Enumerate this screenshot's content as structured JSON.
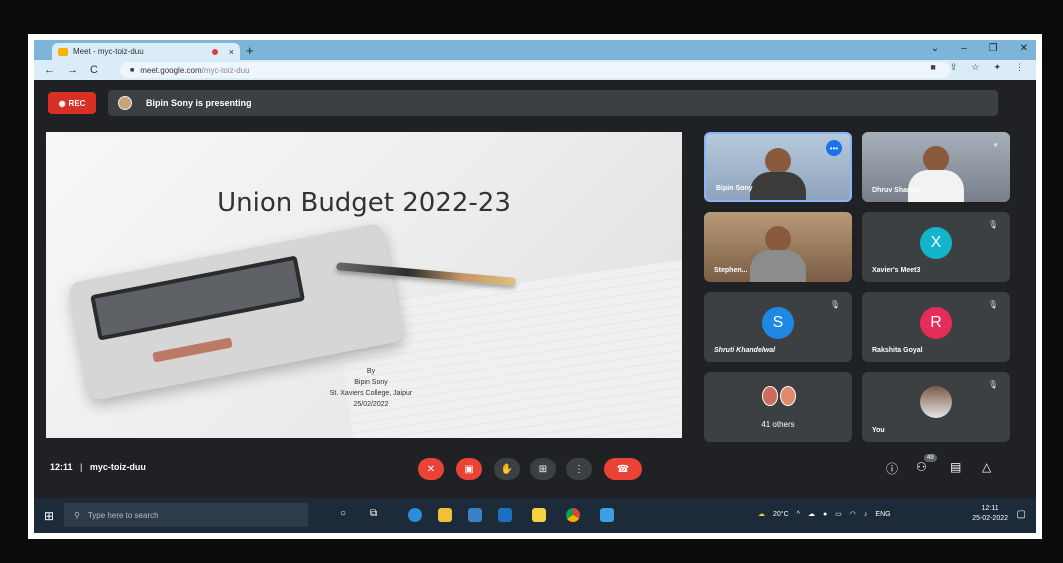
{
  "browser": {
    "tab_title": "Meet - myc-toiz-duu",
    "tab_close": "×",
    "new_tab": "+",
    "url_host": "meet.google.com",
    "url_path": "/myc-toiz-duu",
    "nav_back": "←",
    "nav_forward": "→",
    "nav_reload": "C",
    "lock_icon": "🔒"
  },
  "meet": {
    "rec_label": "REC",
    "presenting_text": "Bipin Sony is presenting",
    "meeting_time": "12:11",
    "meeting_code": "myc-toiz-duu",
    "participants_badge": "49"
  },
  "slide": {
    "title": "Union Budget 2022-23",
    "by": "By",
    "author": "Bipin Sony",
    "institution": "St. Xaviers College, Jaipur",
    "date": "25/02/2022"
  },
  "tiles": [
    {
      "name": "Bipin Sony"
    },
    {
      "name": "Dhruv Sharma"
    },
    {
      "name": "Stephen..."
    },
    {
      "name": "Xavier's Meet3",
      "initial": "X",
      "color": "#12b5cb"
    },
    {
      "name": "Shruti Khandelwal",
      "initial": "S",
      "color": "#1e88e5"
    },
    {
      "name": "Rakshita Goyal",
      "initial": "R",
      "color": "#e52d5a"
    },
    {
      "name": "41 others"
    },
    {
      "name": "You"
    }
  ],
  "taskbar": {
    "search_placeholder": "Type here to search",
    "weather": "20°C",
    "language": "ENG",
    "time": "12:11",
    "date": "25-02-2022"
  }
}
